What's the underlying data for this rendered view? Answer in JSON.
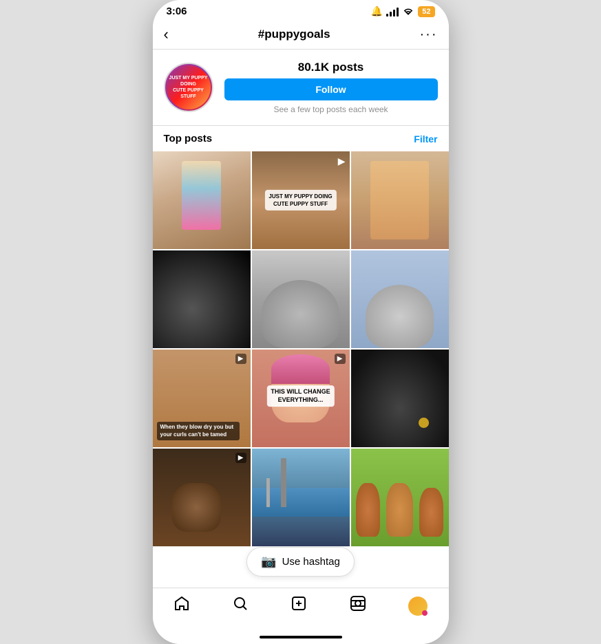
{
  "statusBar": {
    "time": "3:06",
    "battery": "52"
  },
  "nav": {
    "title": "#puppygoals",
    "backLabel": "‹",
    "moreLabel": "···"
  },
  "profile": {
    "avatarText": "JUST MY PUPPY DOING CUTE PUPPY STUFF",
    "postsCount": "80.1K",
    "postsLabel": "posts",
    "followLabel": "Follow",
    "seeTopPosts": "See a few top posts each week"
  },
  "topPosts": {
    "label": "Top posts",
    "filterLabel": "Filter"
  },
  "grid": [
    {
      "id": 1,
      "type": "photo",
      "cssClass": "item-1",
      "hasReelIcon": false,
      "hasVideoIcon": false
    },
    {
      "id": 2,
      "type": "video",
      "cssClass": "item-2",
      "hasVideoIcon": true,
      "overlayText": "JUST MY PUPPY DOING\nCUTE PUPPY STUFF"
    },
    {
      "id": 3,
      "type": "photo",
      "cssClass": "item-3",
      "hasVideoIcon": false
    },
    {
      "id": 4,
      "type": "photo",
      "cssClass": "item-4",
      "hasVideoIcon": false
    },
    {
      "id": 5,
      "type": "photo",
      "cssClass": "item-5",
      "hasVideoIcon": false
    },
    {
      "id": 6,
      "type": "photo",
      "cssClass": "item-6",
      "hasVideoIcon": false
    },
    {
      "id": 7,
      "type": "video",
      "cssClass": "item-7",
      "hasVideoIcon": true,
      "bottomText": "When they blow dry you but your curls can't be tamed"
    },
    {
      "id": 8,
      "type": "video",
      "cssClass": "item-8",
      "hasVideoIcon": true,
      "thisWillChange": "THIS WILL CHANGE\nEVERYTHING..."
    },
    {
      "id": 9,
      "type": "video",
      "cssClass": "item-9",
      "hasVideoIcon": true
    },
    {
      "id": 10,
      "type": "video",
      "cssClass": "item-10",
      "hasVideoIcon": true
    },
    {
      "id": 11,
      "type": "photo",
      "cssClass": "item-11",
      "hasVideoIcon": false
    },
    {
      "id": 12,
      "type": "photo",
      "cssClass": "item-12",
      "hasVideoIcon": false
    }
  ],
  "useHashtag": {
    "label": "Use hashtag"
  },
  "bottomNav": {
    "home": "⌂",
    "search": "🔍",
    "add": "+",
    "reels": "▶",
    "profile": ""
  }
}
